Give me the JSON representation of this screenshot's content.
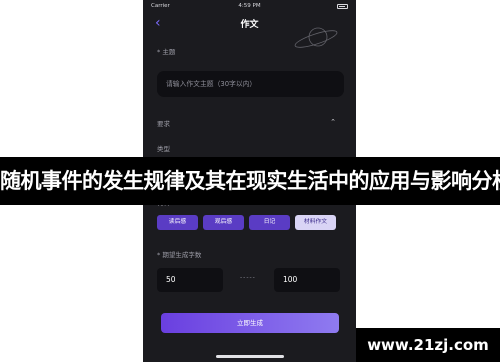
{
  "status_bar": {
    "carrier": "Carrier",
    "time": "4:59 PM"
  },
  "nav": {
    "title": "作文"
  },
  "topic": {
    "label": "* 主题",
    "placeholder": "请输入作文主题（30字以内）"
  },
  "requirements": {
    "label": "要求"
  },
  "type": {
    "label": "类型"
  },
  "material": {
    "label": "材料",
    "chips": [
      "读后感",
      "观后感",
      "日记",
      "材料作文"
    ]
  },
  "word_count": {
    "label": "* 期望生成字数",
    "min": "50",
    "separator": "-----",
    "max": "100"
  },
  "generate_button": {
    "label": "立即生成"
  },
  "overlay": {
    "banner": "随机事件的发生规律及其在现实生活中的应用与影响分析",
    "watermark": "www.21zj.com"
  },
  "colors": {
    "accent": "#7d6cff",
    "chip": "#5a3cc4",
    "background": "#1b1b1f"
  }
}
